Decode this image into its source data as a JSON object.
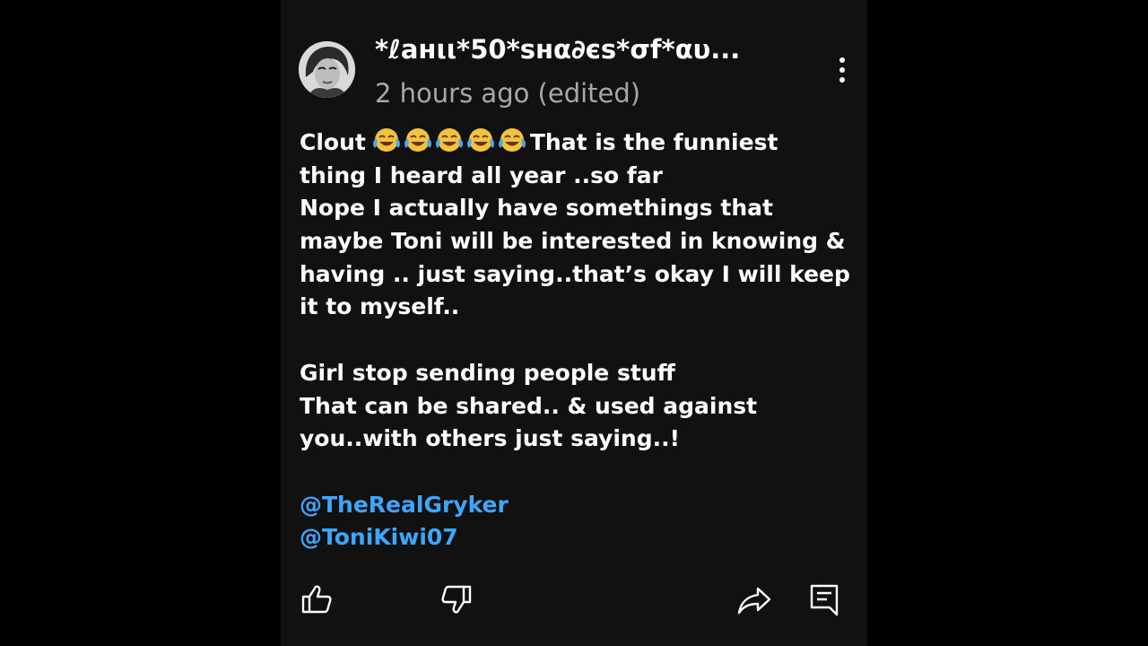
{
  "comment": {
    "author": "*ℓанιι*50*ѕнα∂єѕ*σf*αυ...",
    "timestamp": "2 hours ago (edited)",
    "body": {
      "line1_prefix": "Clout",
      "line1_emojis": [
        "face-with-tears-of-joy",
        "face-with-tears-of-joy",
        "face-with-tears-of-joy",
        "face-with-tears-of-joy",
        "face-with-tears-of-joy"
      ],
      "line1_suffix": "That is the funniest",
      "lines_a": [
        "thing I heard all year ..so far",
        "Nope I actually have somethings that",
        "maybe Toni will be interested in knowing &",
        "having .. just saying..that’s okay I will keep",
        "it to myself.."
      ],
      "lines_b": [
        "Girl stop sending people stuff",
        "That can be shared.. & used against",
        "you..with others just saying..!"
      ],
      "mentions": [
        "@TheRealGryker",
        "@ToniKiwi07"
      ]
    }
  },
  "icons": {
    "more": "more-vert-icon",
    "like": "thumbs-up-icon",
    "dislike": "thumbs-down-icon",
    "share": "share-icon",
    "reply": "reply-comment-icon"
  },
  "colors": {
    "background": "#000000",
    "panel": "#111111",
    "text": "#ffffff",
    "secondary": "#a8a8a8",
    "mention": "#3ea6ff"
  }
}
